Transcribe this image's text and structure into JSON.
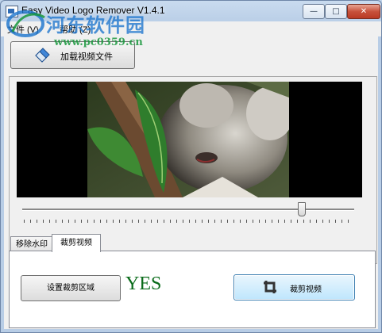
{
  "window": {
    "title": "Easy Video Logo Remover V1.4.1",
    "minimize_glyph": "—",
    "maximize_glyph": "□",
    "close_glyph": "✕"
  },
  "menu": {
    "items": [
      {
        "label": "文件 (V)"
      },
      {
        "label": "帮助 (Z)"
      }
    ]
  },
  "toolbar": {
    "load_video_label": "加载视频文件",
    "load_video_icon": "eraser-icon"
  },
  "player": {
    "preview_content": "koala-video-frame",
    "slider_position": 0.84
  },
  "tabs": [
    {
      "label": "移除水印",
      "selected": false
    },
    {
      "label": "裁剪视频",
      "selected": true
    }
  ],
  "crop_panel": {
    "set_crop_area_label": "设置裁剪区域",
    "status_text": "YES",
    "crop_button_label": "裁剪视频",
    "crop_button_icon": "crop-icon"
  },
  "watermark": {
    "site_name": "河东软件园",
    "site_url": "www.pc0359.cn"
  },
  "colors": {
    "status_green": "#0a6b1a",
    "watermark_blue": "#1c74cd",
    "watermark_green": "#18963c",
    "close_button_red": "#c8523c"
  }
}
